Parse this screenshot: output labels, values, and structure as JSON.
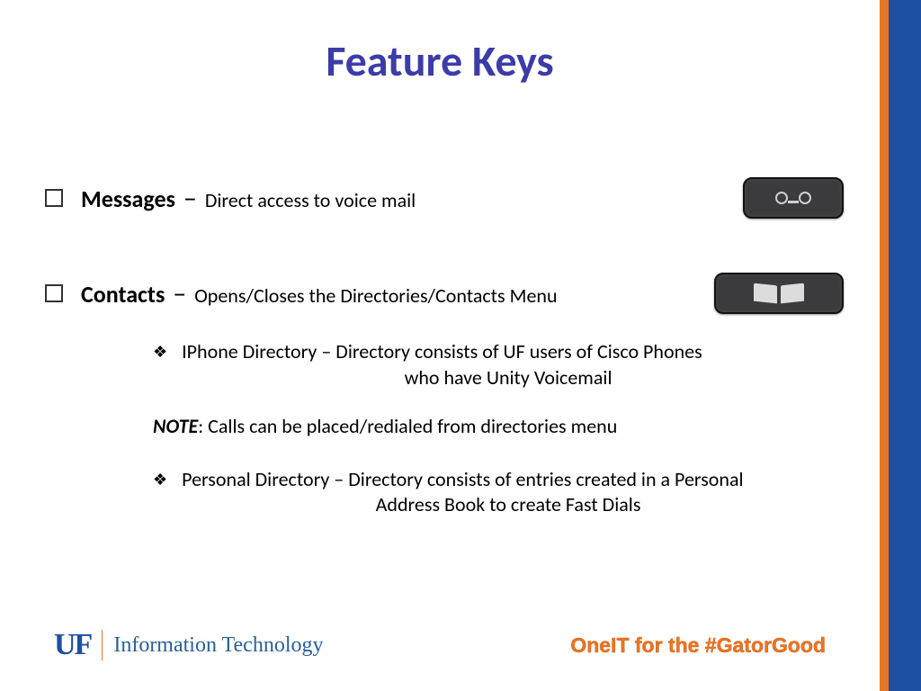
{
  "title": "Feature Keys",
  "items": [
    {
      "label": "Messages",
      "dash": "–",
      "desc": "Direct access to voice mail",
      "icon": "voicemail-icon"
    },
    {
      "label": "Contacts",
      "dash": "–",
      "desc": "Opens/Closes the Directories/Contacts Menu",
      "icon": "book-icon"
    }
  ],
  "sub": {
    "a_line1": "IPhone Directory – Directory consists of UF users of Cisco Phones",
    "a_line2": "who have Unity Voicemail",
    "note_label": "NOTE",
    "note_text": ":  Calls can be placed/redialed from directories menu",
    "b_line1": "Personal Directory – Directory consists of entries created in a Personal",
    "b_line2": "Address Book to create Fast Dials"
  },
  "footer": {
    "uf": "UF",
    "dept": "Information Technology",
    "tagline": "OneIT for the #GatorGood"
  }
}
